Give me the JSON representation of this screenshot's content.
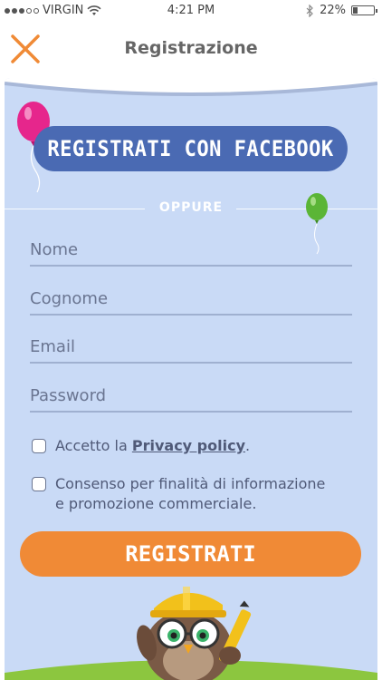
{
  "status_bar": {
    "carrier": "VIRGIN",
    "time": "4:21 PM",
    "battery_percent_label": "22%",
    "battery_level": 0.22
  },
  "nav": {
    "title": "Registrazione",
    "close_icon": "close-x-icon"
  },
  "facebook_button": {
    "label": "REGISTRATI CON FACEBOOK"
  },
  "divider": {
    "label": "OPPURE"
  },
  "form": {
    "nome_placeholder": "Nome",
    "cognome_placeholder": "Cognome",
    "email_placeholder": "Email",
    "password_placeholder": "Password"
  },
  "privacy": {
    "prefix": "Accetto la ",
    "link": "Privacy policy",
    "suffix": "."
  },
  "consent": {
    "line1": "Consenso per finalità di informazione",
    "line2": "e promozione commerciale."
  },
  "register_button": {
    "label": "REGISTRATI"
  },
  "colors": {
    "accent_orange": "#f08a36",
    "facebook_blue": "#4a6ab3",
    "panel_blue": "#c9daf6"
  }
}
